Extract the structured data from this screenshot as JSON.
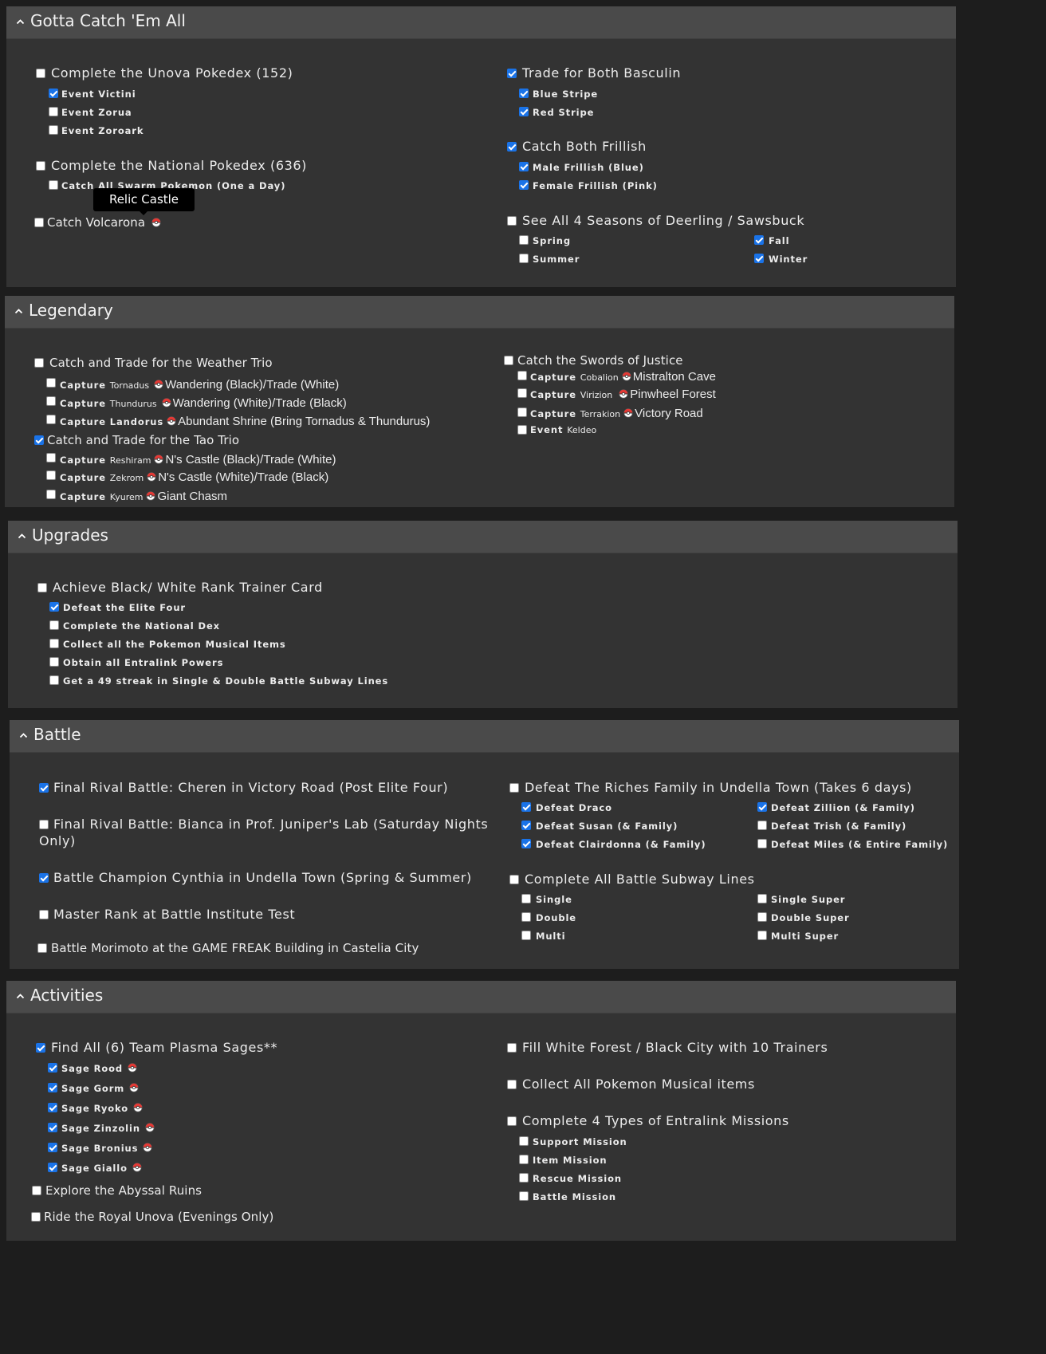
{
  "sections": {
    "catch": {
      "title": "Gotta Catch 'Em All",
      "unova_dex": "Complete the Unova Pokedex (152)",
      "event_victini": "Event Victini",
      "event_zorua": "Event Zorua",
      "event_zoroark": "Event Zoroark",
      "national_dex": "Complete the National Pokedex (636)",
      "swarm": "Catch All Swarm Pokemon (One a Day)",
      "volcarona": "Catch Volcarona",
      "tooltip": "Relic Castle",
      "basculin": "Trade for Both Basculin",
      "blue_stripe": "Blue Stripe",
      "red_stripe": "Red Stripe",
      "frillish": "Catch Both Frillish",
      "male_frillish": "Male Frillish (Blue)",
      "female_frillish": "Female Frillish (Pink)",
      "seasons": "See All 4 Seasons of Deerling / Sawsbuck",
      "spring": "Spring",
      "summer": "Summer",
      "fall": "Fall",
      "winter": "Winter"
    },
    "legendary": {
      "title": "Legendary",
      "weather_trio": "Catch and Trade for the Weather Trio",
      "capture": "Capture",
      "event": "Event",
      "tornadus": "Tornadus",
      "tornadus_loc": "Wandering (Black)/Trade (White)",
      "thundurus": "Thundurus",
      "thundurus_loc": "Wandering (White)/Trade (Black)",
      "landorus": "Landorus",
      "landorus_loc": "Abundant Shrine (Bring Tornadus & Thundurus)",
      "tao_trio": "Catch and Trade for the Tao Trio",
      "reshiram": "Reshiram",
      "reshiram_loc": "N's Castle (Black)/Trade (White)",
      "zekrom": "Zekrom",
      "zekrom_loc": "N's Castle (White)/Trade (Black)",
      "kyurem": "Kyurem",
      "kyurem_loc": "Giant Chasm",
      "swords": "Catch the Swords of Justice",
      "cobalion": "Cobalion",
      "cobalion_loc": "Mistralton Cave",
      "virizion": "Virizion",
      "virizion_loc": "Pinwheel Forest",
      "terrakion": "Terrakion",
      "terrakion_loc": "Victory Road",
      "keldeo": "Keldeo"
    },
    "upgrades": {
      "title": "Upgrades",
      "trainer_card": "Achieve Black/ White Rank Trainer Card",
      "elite_four": "Defeat the Elite Four",
      "national_dex": "Complete the National Dex",
      "musical": "Collect all the Pokemon Musical Items",
      "entralink": "Obtain all Entralink Powers",
      "streak": "Get a 49 streak in Single & Double Battle Subway Lines"
    },
    "battle": {
      "title": "Battle",
      "cheren": "Final Rival Battle: Cheren in Victory Road (Post Elite Four)",
      "bianca_1": "Final Rival Battle: Bianca in Prof. Juniper's Lab (Saturday Nights",
      "bianca_2": "Only)",
      "cynthia": "Battle Champion Cynthia in Undella Town (Spring & Summer)",
      "master_rank": "Master Rank at Battle Institute Test",
      "morimoto": "Battle Morimoto at the GAME FREAK Building in Castelia City",
      "riches": "Defeat The Riches Family in Undella Town (Takes 6 days)",
      "draco": "Defeat Draco",
      "susan": "Defeat Susan (& Family)",
      "clairdonna": "Defeat Clairdonna (& Family)",
      "zillion": "Defeat Zillion (& Family)",
      "trish": "Defeat Trish (& Family)",
      "miles": "Defeat Miles (& Entire Family)",
      "subway": "Complete All Battle Subway Lines",
      "single": "Single",
      "double": "Double",
      "multi": "Multi",
      "single_super": "Single Super",
      "double_super": "Double Super",
      "multi_super": "Multi Super"
    },
    "activities": {
      "title": "Activities",
      "sages": "Find All (6) Team Plasma Sages**",
      "rood": "Sage Rood",
      "gorm": "Sage Gorm",
      "ryoko": "Sage Ryoko",
      "zinzolin": "Sage Zinzolin",
      "bronius": "Sage Bronius",
      "giallo": "Sage Giallo",
      "abyssal": "Explore the Abyssal Ruins",
      "royal": "Ride the Royal Unova (Evenings Only)",
      "white_forest": "Fill White Forest / Black City with 10 Trainers",
      "musical_items": "Collect All Pokemon Musical items",
      "entralink_missions": "Complete 4 Types of Entralink Missions",
      "support": "Support Mission",
      "item": "Item Mission",
      "rescue": "Rescue Mission",
      "battle_mission": "Battle Mission"
    }
  },
  "icons": {
    "caret": "chevron-up-icon",
    "ball": "pokeball-icon"
  },
  "colors": {
    "checkbox_checked": "#1a73e8",
    "panel": "#333333",
    "header": "#4a4a4a"
  }
}
